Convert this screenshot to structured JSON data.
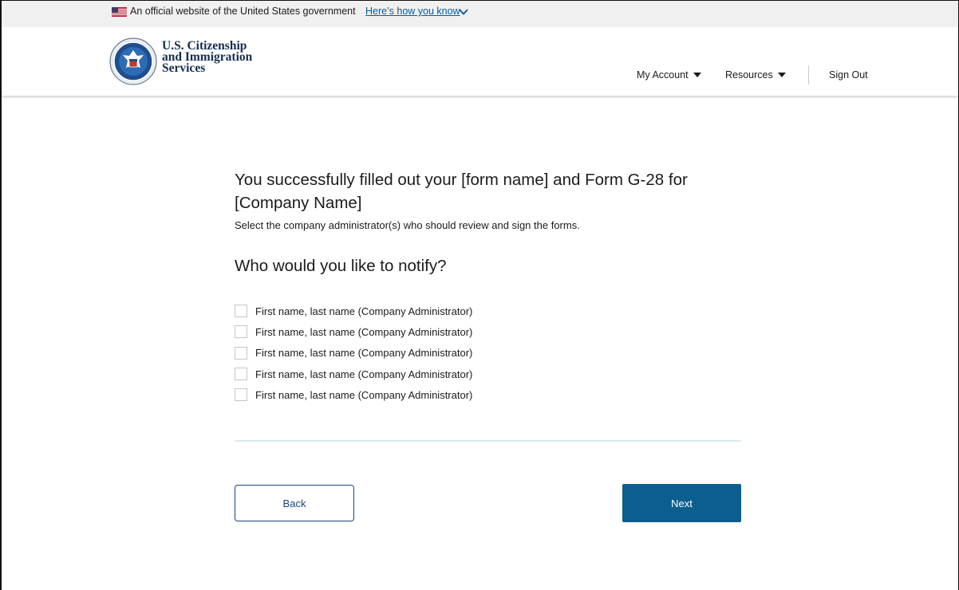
{
  "gov_banner": {
    "text": "An official website of the United States government",
    "link": "Here’s how you know"
  },
  "header": {
    "agency_line1": "U.S. Citizenship",
    "agency_line2": "and Immigration",
    "agency_line3": "Services",
    "nav": {
      "my_account": "My Account",
      "resources": "Resources",
      "sign_out": "Sign Out"
    }
  },
  "main": {
    "title": "You successfully filled out your [form name] and Form G-28 for [Company Name]",
    "subtitle": "Select the company administrator(s) who should review and sign the forms.",
    "question": "Who would you like to notify?",
    "administrators": [
      {
        "label": "First name, last name (Company Administrator)",
        "checked": false
      },
      {
        "label": "First name, last name (Company Administrator)",
        "checked": false
      },
      {
        "label": "First name, last name (Company Administrator)",
        "checked": false
      },
      {
        "label": "First name, last name (Company Administrator)",
        "checked": false
      },
      {
        "label": "First name, last name (Company Administrator)",
        "checked": false
      }
    ]
  },
  "actions": {
    "back": "Back",
    "next": "Next"
  },
  "colors": {
    "primary": "#0b5e8e",
    "link": "#005ea2",
    "agency_text": "#162e51",
    "banner_bg": "#f0f0f0"
  }
}
